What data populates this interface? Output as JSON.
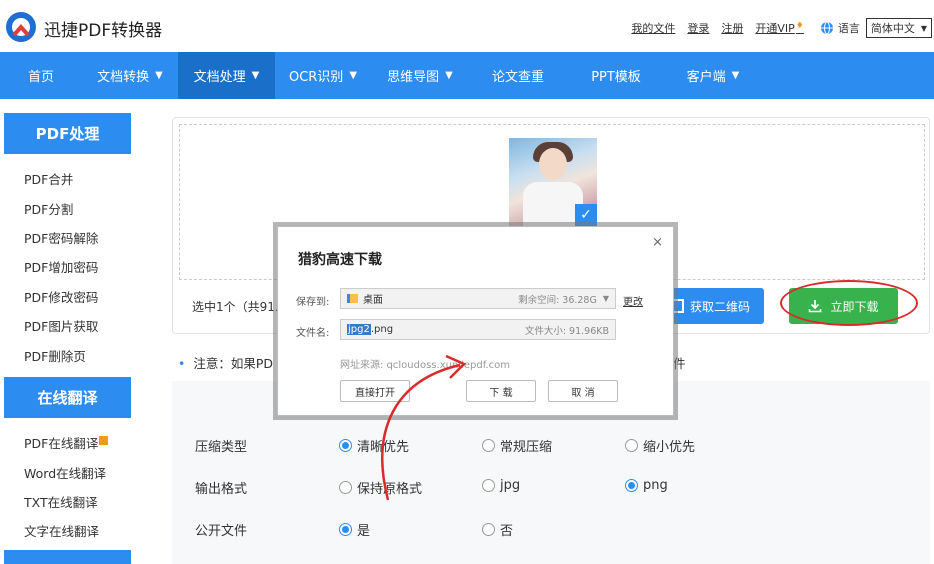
{
  "header": {
    "app_name": "迅捷PDF转换器",
    "links": [
      "我的文件",
      "登录",
      "注册",
      "开通VIP"
    ],
    "lang_label": "语言",
    "lang_value": "简体中文"
  },
  "nav": {
    "items": [
      {
        "label": "首页",
        "dropdown": false
      },
      {
        "label": "文档转换",
        "dropdown": true
      },
      {
        "label": "文档处理",
        "dropdown": true,
        "active": true
      },
      {
        "label": "OCR识别",
        "dropdown": true
      },
      {
        "label": "思维导图",
        "dropdown": true
      },
      {
        "label": "论文查重",
        "dropdown": false
      },
      {
        "label": "PPT模板",
        "dropdown": false
      },
      {
        "label": "客户端",
        "dropdown": true
      }
    ]
  },
  "sidebar": {
    "group1_title": "PDF处理",
    "group1_items": [
      "PDF合并",
      "PDF分割",
      "PDF密码解除",
      "PDF增加密码",
      "PDF修改密码",
      "PDF图片获取",
      "PDF删除页"
    ],
    "group2_title": "在线翻译",
    "group2_items": [
      "PDF在线翻译",
      "Word在线翻译",
      "TXT在线翻译",
      "文字在线翻译"
    ]
  },
  "main": {
    "selected_info": "选中1个（共91.9",
    "qr_button": "获取二维码",
    "download_button": "立即下载",
    "notice": "注意：如果PD",
    "notice_tail": "件",
    "options": {
      "compress_label": "压缩类型",
      "compress_options": [
        "清晰优先",
        "常规压缩",
        "缩小优先"
      ],
      "compress_selected": 0,
      "format_label": "输出格式",
      "format_options": [
        "保持原格式",
        "jpg",
        "png"
      ],
      "format_selected": 2,
      "public_label": "公开文件",
      "public_options": [
        "是",
        "否"
      ],
      "public_selected": 0
    }
  },
  "dialog": {
    "title": "猎豹高速下载",
    "close": "×",
    "save_label": "保存到:",
    "save_value": "桌面",
    "free_space": "剩余空间: 36.28G",
    "change": "更改",
    "filename_label": "文件名:",
    "filename_selected": "jpg2",
    "filename_ext": ".png",
    "file_size": "文件大小: 91.96KB",
    "source": "网址来源: qcloudoss.xunjiepdf.com",
    "btn_open": "直接打开",
    "btn_download": "下 载",
    "btn_cancel": "取 消"
  },
  "colors": {
    "primary": "#2d8cf0",
    "nav_active": "#1a6fc8",
    "download_green": "#37b24d",
    "annotation_red": "#d92b2b"
  }
}
